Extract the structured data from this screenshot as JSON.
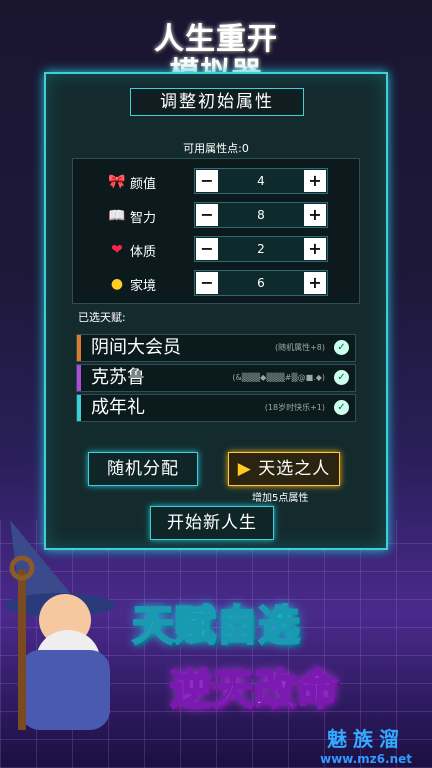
{
  "title_line1": "人生重开",
  "title_line2": "模拟器",
  "panel": {
    "subtitle": "调整初始属性",
    "points_label": "可用属性点:0",
    "attributes": [
      {
        "icon": "bow-icon",
        "name": "颜值",
        "value": "4"
      },
      {
        "icon": "book-icon",
        "name": "智力",
        "value": "8"
      },
      {
        "icon": "heart-icon",
        "name": "体质",
        "value": "2"
      },
      {
        "icon": "coin-icon",
        "name": "家境",
        "value": "6"
      }
    ],
    "minus": "−",
    "plus": "+",
    "talents_label": "已选天赋:",
    "talents": [
      {
        "name": "阴间大会员",
        "desc": "(随机属性+8)",
        "color": "#e07a2a"
      },
      {
        "name": "克苏鲁",
        "desc": "(&▒▒▒◆▒▒▒#▒@■.◆)",
        "color": "#b04ad8"
      },
      {
        "name": "成年礼",
        "desc": "(18岁时快乐+1)",
        "color": "#3ad1d8"
      }
    ],
    "random_button": "随机分配",
    "chosen_button": "天选之人",
    "chosen_sub": "增加5点属性",
    "start_button": "开始新人生"
  },
  "slogan1": "天赋自选",
  "slogan2": "逆天改命",
  "watermark1": "魅族溜",
  "watermark2": "www.mz6.net"
}
